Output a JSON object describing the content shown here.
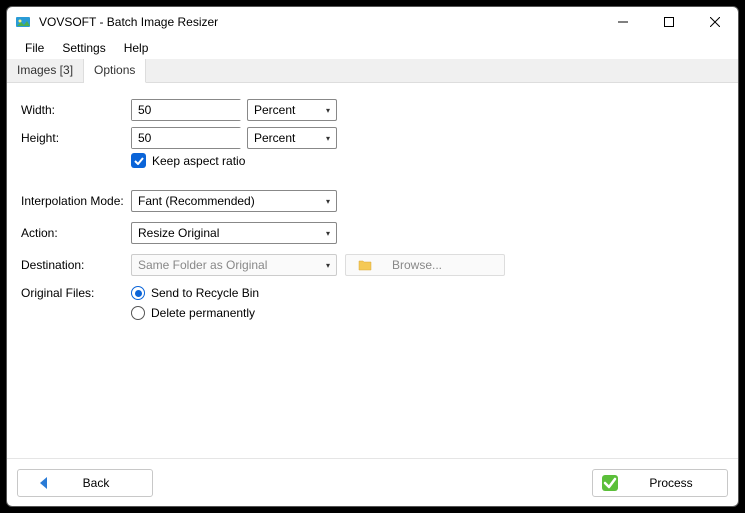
{
  "window": {
    "title": "VOVSOFT - Batch Image Resizer"
  },
  "menu": {
    "file": "File",
    "settings": "Settings",
    "help": "Help"
  },
  "tabs": {
    "images": "Images [3]",
    "options": "Options"
  },
  "labels": {
    "width": "Width:",
    "height": "Height:",
    "aspect": "Keep aspect ratio",
    "interp": "Interpolation Mode:",
    "action": "Action:",
    "destination": "Destination:",
    "original": "Original Files:",
    "recycle": "Send to Recycle Bin",
    "delete": "Delete permanently"
  },
  "values": {
    "width": "50",
    "height": "50",
    "width_unit": "Percent",
    "height_unit": "Percent",
    "interp": "Fant (Recommended)",
    "action": "Resize Original",
    "destination": "Same Folder as Original",
    "browse": "Browse..."
  },
  "buttons": {
    "back": "Back",
    "process": "Process"
  }
}
